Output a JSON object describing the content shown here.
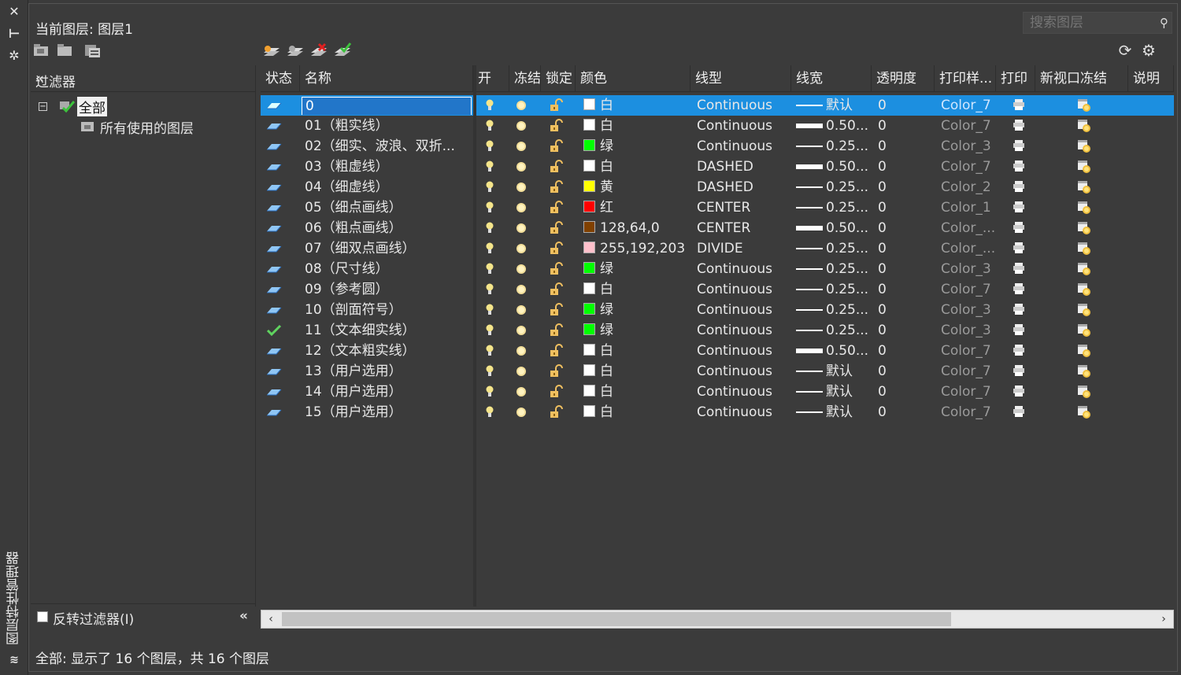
{
  "sidebar": {
    "title": "图层特性管理器"
  },
  "header": {
    "current_layer": "当前图层: 图层1",
    "search_placeholder": "搜索图层"
  },
  "filter": {
    "title": "过滤器",
    "tree": [
      {
        "label": "全部"
      },
      {
        "label": "所有使用的图层"
      }
    ],
    "invert_label": "反转过滤器(I)"
  },
  "columns": [
    "状态",
    "名称",
    "开",
    "冻结",
    "锁定",
    "颜色",
    "线型",
    "线宽",
    "透明度",
    "打印样...",
    "打印",
    "新视口冻结",
    "说明"
  ],
  "layers": [
    {
      "status": "current",
      "name": "0",
      "color_name": "白",
      "color": "#ffffff",
      "linetype": "Continuous",
      "lineweight": "默认",
      "lw_thick": false,
      "transparency": "0",
      "plot_style": "Color_7"
    },
    {
      "status": "normal",
      "name": "01（粗实线）",
      "color_name": "白",
      "color": "#ffffff",
      "linetype": "Continuous",
      "lineweight": "0.50...",
      "lw_thick": true,
      "transparency": "0",
      "plot_style": "Color_7"
    },
    {
      "status": "normal",
      "name": "02（细实、波浪、双折...",
      "color_name": "绿",
      "color": "#00ff00",
      "linetype": "Continuous",
      "lineweight": "0.25...",
      "lw_thick": false,
      "transparency": "0",
      "plot_style": "Color_3"
    },
    {
      "status": "normal",
      "name": "03（粗虚线）",
      "color_name": "白",
      "color": "#ffffff",
      "linetype": "DASHED",
      "lineweight": "0.50...",
      "lw_thick": true,
      "transparency": "0",
      "plot_style": "Color_7"
    },
    {
      "status": "normal",
      "name": "04（细虚线）",
      "color_name": "黄",
      "color": "#ffff00",
      "linetype": "DASHED",
      "lineweight": "0.25...",
      "lw_thick": false,
      "transparency": "0",
      "plot_style": "Color_2"
    },
    {
      "status": "normal",
      "name": "05（细点画线）",
      "color_name": "红",
      "color": "#ff0000",
      "linetype": "CENTER",
      "lineweight": "0.25...",
      "lw_thick": false,
      "transparency": "0",
      "plot_style": "Color_1"
    },
    {
      "status": "normal",
      "name": "06（粗点画线）",
      "color_name": "128,64,0",
      "color": "#804000",
      "linetype": "CENTER",
      "lineweight": "0.50...",
      "lw_thick": true,
      "transparency": "0",
      "plot_style": "Color_..."
    },
    {
      "status": "normal",
      "name": "07（细双点画线）",
      "color_name": "255,192,203",
      "color": "#ffc0cb",
      "linetype": "DIVIDE",
      "lineweight": "0.25...",
      "lw_thick": false,
      "transparency": "0",
      "plot_style": "Color_..."
    },
    {
      "status": "normal",
      "name": "08（尺寸线）",
      "color_name": "绿",
      "color": "#00ff00",
      "linetype": "Continuous",
      "lineweight": "0.25...",
      "lw_thick": false,
      "transparency": "0",
      "plot_style": "Color_3"
    },
    {
      "status": "normal",
      "name": "09（参考圆）",
      "color_name": "白",
      "color": "#ffffff",
      "linetype": "Continuous",
      "lineweight": "0.25...",
      "lw_thick": false,
      "transparency": "0",
      "plot_style": "Color_7"
    },
    {
      "status": "normal",
      "name": "10（剖面符号）",
      "color_name": "绿",
      "color": "#00ff00",
      "linetype": "Continuous",
      "lineweight": "0.25...",
      "lw_thick": false,
      "transparency": "0",
      "plot_style": "Color_3"
    },
    {
      "status": "check",
      "name": "11（文本细实线）",
      "color_name": "绿",
      "color": "#00ff00",
      "linetype": "Continuous",
      "lineweight": "0.25...",
      "lw_thick": false,
      "transparency": "0",
      "plot_style": "Color_3"
    },
    {
      "status": "normal",
      "name": "12（文本粗实线）",
      "color_name": "白",
      "color": "#ffffff",
      "linetype": "Continuous",
      "lineweight": "0.50...",
      "lw_thick": true,
      "transparency": "0",
      "plot_style": "Color_7"
    },
    {
      "status": "normal",
      "name": "13（用户选用）",
      "color_name": "白",
      "color": "#ffffff",
      "linetype": "Continuous",
      "lineweight": "默认",
      "lw_thick": false,
      "transparency": "0",
      "plot_style": "Color_7"
    },
    {
      "status": "normal",
      "name": "14（用户选用）",
      "color_name": "白",
      "color": "#ffffff",
      "linetype": "Continuous",
      "lineweight": "默认",
      "lw_thick": false,
      "transparency": "0",
      "plot_style": "Color_7"
    },
    {
      "status": "normal",
      "name": "15（用户选用）",
      "color_name": "白",
      "color": "#ffffff",
      "linetype": "Continuous",
      "lineweight": "默认",
      "lw_thick": false,
      "transparency": "0",
      "plot_style": "Color_7"
    }
  ],
  "status_bar": "全部: 显示了 16 个图层，共 16 个图层"
}
